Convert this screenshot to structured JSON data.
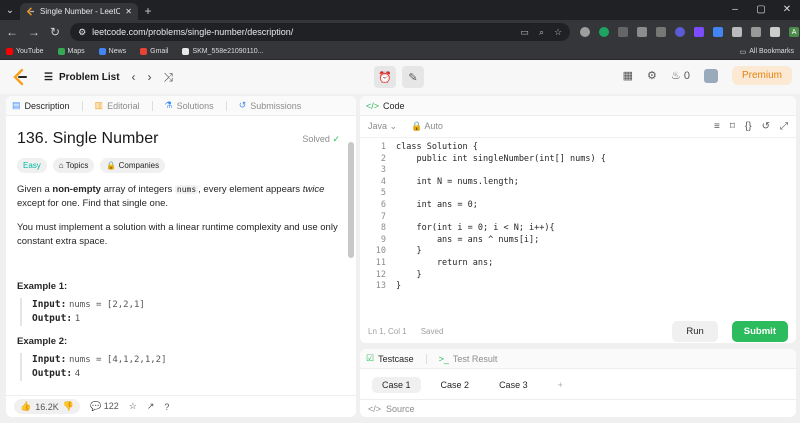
{
  "browser": {
    "tab_title": "Single Number - LeetCode",
    "url": "leetcode.com/problems/single-number/description/",
    "bookmarks": [
      {
        "label": "YouTube",
        "color": "#ff0000"
      },
      {
        "label": "Maps",
        "color": "#34a853"
      },
      {
        "label": "News",
        "color": "#4285f4"
      },
      {
        "label": "Gmail",
        "color": "#ea4335"
      },
      {
        "label": "SKM_558e21090110...",
        "color": "#e8e8e8"
      }
    ],
    "all_bookmarks": "All Bookmarks",
    "profile_initial": "A"
  },
  "header": {
    "problem_list": "Problem List",
    "streak": "0",
    "premium": "Premium"
  },
  "left": {
    "tabs": [
      "Description",
      "Editorial",
      "Solutions",
      "Submissions"
    ],
    "title": "136. Single Number",
    "solved": "Solved",
    "pills": [
      "Easy",
      "Topics",
      "Companies"
    ],
    "desc1_a": "Given a ",
    "desc1_b": "non-empty",
    "desc1_c": " array of integers ",
    "desc1_code": "nums",
    "desc1_d": ", every element appears ",
    "desc1_e": "twice",
    "desc1_f": " except for one. Find that single one.",
    "desc2": "You must implement a solution with a linear runtime complexity and use only constant extra space.",
    "examples": [
      {
        "heading": "Example 1:",
        "input_label": "Input:",
        "input": "nums = [2,2,1]",
        "output_label": "Output:",
        "output": "1"
      },
      {
        "heading": "Example 2:",
        "input_label": "Input:",
        "input": "nums = [4,1,2,1,2]",
        "output_label": "Output:",
        "output": "4"
      }
    ],
    "likes": "16.2K",
    "comments": "122"
  },
  "code": {
    "tab": "Code",
    "language": "Java",
    "mode": "Auto",
    "lines": [
      "class Solution {",
      "    public int singleNumber(int[] nums) {",
      "",
      "    int N = nums.length;",
      "",
      "    int ans = 0;",
      "",
      "    for(int i = 0; i < N; i++){",
      "        ans = ans ^ nums[i];",
      "    }",
      "        return ans;",
      "    }",
      "}"
    ],
    "status_pos": "Ln 1, Col 1",
    "status_saved": "Saved",
    "run": "Run",
    "submit": "Submit"
  },
  "test": {
    "tab_testcase": "Testcase",
    "tab_result": "Test Result",
    "cases": [
      "Case 1",
      "Case 2",
      "Case 3"
    ],
    "source": "Source"
  },
  "colors": {
    "accent_green": "#2cbb5d",
    "easy": "#00b8a3",
    "premium": "#e6820e"
  }
}
